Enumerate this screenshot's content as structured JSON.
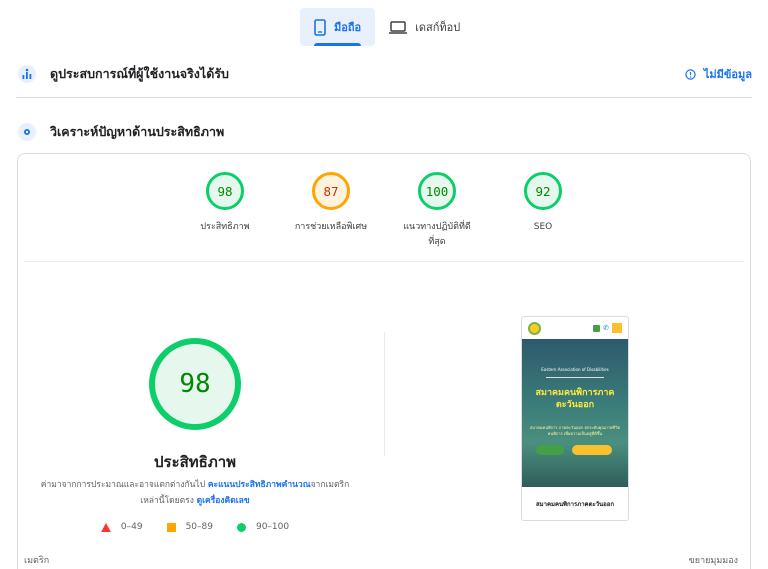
{
  "tabs": {
    "mobile_label": "มือถือ",
    "desktop_label": "เดสก์ท็อป"
  },
  "field_data": {
    "title": "ดูประสบการณ์ที่ผู้ใช้งานจริงได้รับ",
    "no_data": "ไม่มีข้อมูล"
  },
  "diagnose": {
    "title": "วิเคราะห์ปัญหาด้านประสิทธิภาพ"
  },
  "scores": [
    {
      "value": "98",
      "label": "ประสิทธิภาพ",
      "status": "good"
    },
    {
      "value": "87",
      "label": "การช่วยเหลือพิเศษ",
      "status": "average"
    },
    {
      "value": "100",
      "label": "แนวทางปฏิบัติที่ดีที่สุด",
      "status": "good"
    },
    {
      "value": "92",
      "label": "SEO",
      "status": "good"
    }
  ],
  "performance": {
    "score": "98",
    "title": "ประสิทธิภาพ",
    "desc_part1": "ค่ามาจากการประมาณและอาจแตกต่างกันไป",
    "desc_link1": "คะแนนประสิทธิภาพคำนวณ",
    "desc_part2": "จากเมตริกเหล่านี้โดยตรง",
    "desc_link2": "ดูเครื่องคิดเลข"
  },
  "legend": {
    "poor": "0–49",
    "average": "50–89",
    "good": "90–100"
  },
  "screenshot": {
    "small_text": "Eastern Association of Disabilities",
    "big_text": "สมาคมคนพิการภาคตะวันออก",
    "sub_text": "สมาคมคนพิการ ภาคตะวันออก ยกระดับคุณภาพชีวิต คนพิการ เพื่อความเป็นอยู่ที่ดีขึ้น",
    "footer": "สมาคมคนพิการภาคตะวันออก"
  },
  "footer": {
    "metrics": "เมตริก",
    "expand": "ขยายมุมมอง"
  },
  "colors": {
    "accent": "#1a73e8",
    "good": "#0cce6b",
    "average": "#ffa400",
    "poor": "#ff3333"
  }
}
